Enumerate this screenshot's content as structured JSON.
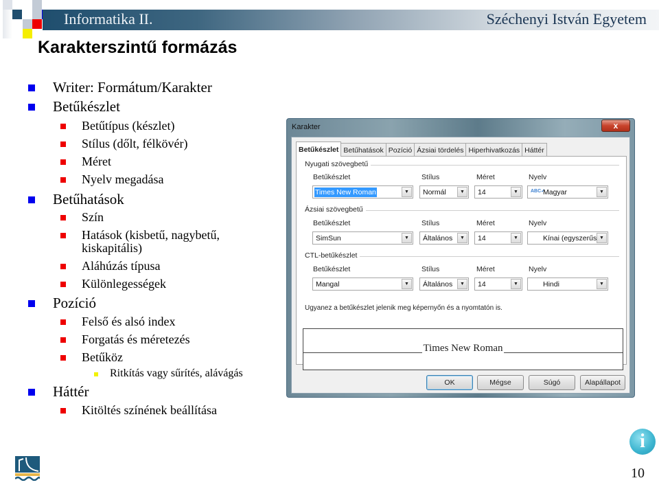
{
  "header": {
    "course_title": "Informatika II.",
    "university": "Széchenyi István Egyetem"
  },
  "slide": {
    "title": "Karakterszintű formázás",
    "page_number": "10"
  },
  "outline": [
    {
      "level": 1,
      "text": "Writer: Formátum/Karakter"
    },
    {
      "level": 1,
      "text": "Betűkészlet"
    },
    {
      "level": 2,
      "text": "Betűtípus (készlet)"
    },
    {
      "level": 2,
      "text": "Stílus (dőlt, félkövér)"
    },
    {
      "level": 2,
      "text": "Méret"
    },
    {
      "level": 2,
      "text": "Nyelv megadása"
    },
    {
      "level": 1,
      "text": "Betűhatások"
    },
    {
      "level": 2,
      "text": "Szín"
    },
    {
      "level": 2,
      "text": "Hatások (kisbetű, nagybetű,"
    },
    {
      "level": 2,
      "text": "kiskapitális)",
      "continuation": true
    },
    {
      "level": 2,
      "text": "Aláhúzás típusa"
    },
    {
      "level": 2,
      "text": "Különlegességek"
    },
    {
      "level": 1,
      "text": "Pozíció"
    },
    {
      "level": 2,
      "text": "Felső és alsó index"
    },
    {
      "level": 2,
      "text": "Forgatás és méretezés"
    },
    {
      "level": 2,
      "text": "Betűköz"
    },
    {
      "level": 3,
      "text": "Ritkítás vagy sűrítés, alávágás"
    },
    {
      "level": 1,
      "text": "Háttér"
    },
    {
      "level": 2,
      "text": "Kitöltés színének beállítása"
    }
  ],
  "dialog": {
    "title": "Karakter",
    "close_label": "x",
    "tabs": [
      "Betűkészlet",
      "Betűhatások",
      "Pozíció",
      "Ázsiai tördelés",
      "Hiperhivatkozás",
      "Háttér"
    ],
    "active_tab": "Betűkészlet",
    "sections": [
      {
        "label": "Nyugati szövegbetű",
        "font_label": "Betűkészlet",
        "font_value": "Times New Roman",
        "style_label": "Stílus",
        "style_value": "Normál",
        "size_label": "Méret",
        "size_value": "14",
        "lang_label": "Nyelv",
        "lang_value": "Magyar"
      },
      {
        "label": "Ázsiai szövegbetű",
        "font_label": "Betűkészlet",
        "font_value": "SimSun",
        "style_label": "Stílus",
        "style_value": "Általános",
        "size_label": "Méret",
        "size_value": "14",
        "lang_label": "Nyelv",
        "lang_value": "Kínai (egyszerűsít"
      },
      {
        "label": "CTL-betűkészlet",
        "font_label": "Betűkészlet",
        "font_value": "Mangal",
        "style_label": "Stílus",
        "style_value": "Általános",
        "size_label": "Méret",
        "size_value": "14",
        "lang_label": "Nyelv",
        "lang_value": "Hindi"
      }
    ],
    "info_text": "Ugyanez a betűkészlet jelenik meg képernyőn és a nyomtatón is.",
    "preview_text": "Times New Roman",
    "buttons": {
      "ok": "OK",
      "cancel": "Mégse",
      "help": "Súgó",
      "reset": "Alapállapot"
    }
  },
  "colors": {
    "level1_bullet": "#0000ee",
    "level2_bullet": "#ee0000",
    "level3_bullet": "#f2f200",
    "header_dark": "#1f4e6e",
    "selection": "#3399ff"
  }
}
